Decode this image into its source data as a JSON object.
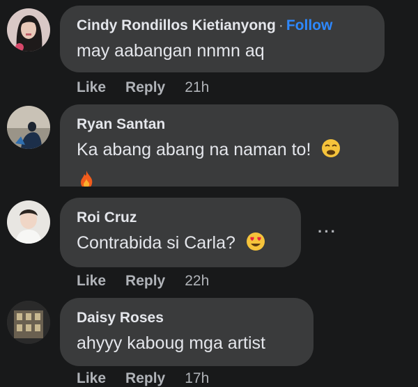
{
  "comments": [
    {
      "name": "Cindy Rondillos Kietianyong",
      "separator": "·",
      "follow_label": "Follow",
      "text": "may aabangan nnmn aq",
      "like_label": "Like",
      "reply_label": "Reply",
      "time": "21h"
    },
    {
      "name": "Ryan Santan",
      "text": "Ka abang abang na naman to!",
      "emoji": "weary-face",
      "emoji2": "fire"
    },
    {
      "name": "Roi Cruz",
      "text": "Contrabida si Carla?",
      "emoji": "heart-eyes-face",
      "more_label": "···",
      "like_label": "Like",
      "reply_label": "Reply",
      "time": "22h"
    },
    {
      "name": "Daisy Roses",
      "text": "ahyyy kaboug mga artist",
      "like_label": "Like",
      "reply_label": "Reply",
      "time": "17h"
    }
  ]
}
